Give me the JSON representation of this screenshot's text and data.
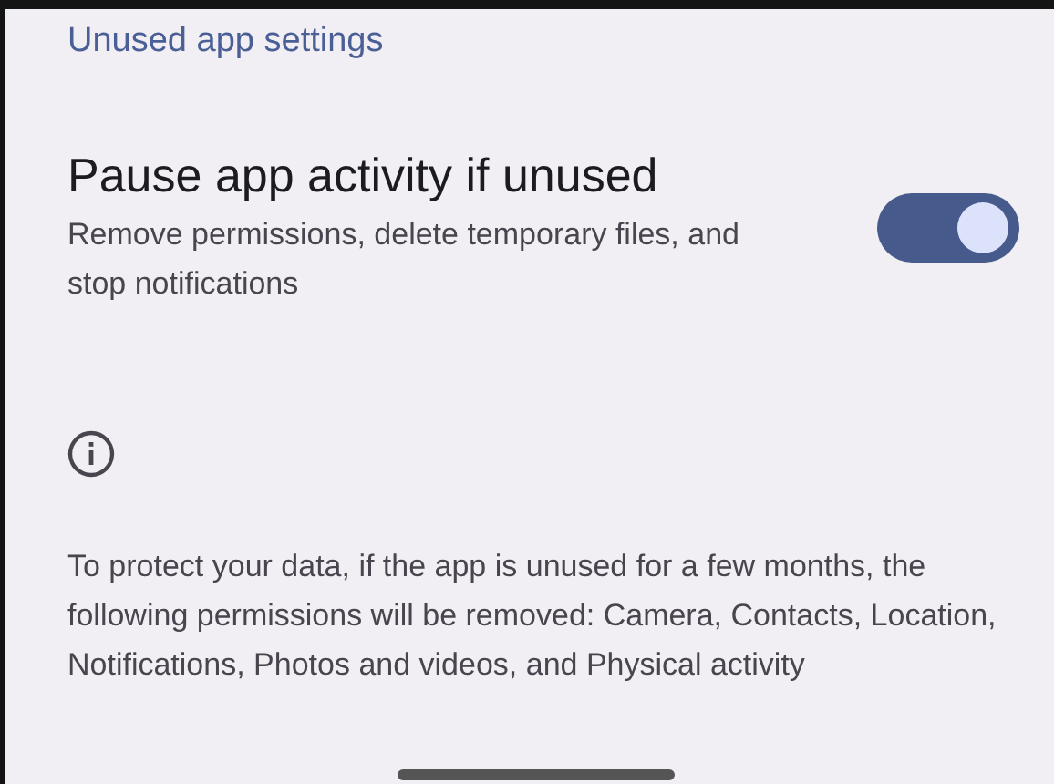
{
  "header": {
    "title": "Unused app settings"
  },
  "setting": {
    "title": "Pause app activity if unused",
    "summary": "Remove permissions, delete temporary files, and stop notifications",
    "on": true
  },
  "info": {
    "text": "To protect your data, if the app is unused for a few months, the following permissions will be removed: Camera, Contacts, Location, Notifications, Photos and videos, and Physical activity"
  }
}
